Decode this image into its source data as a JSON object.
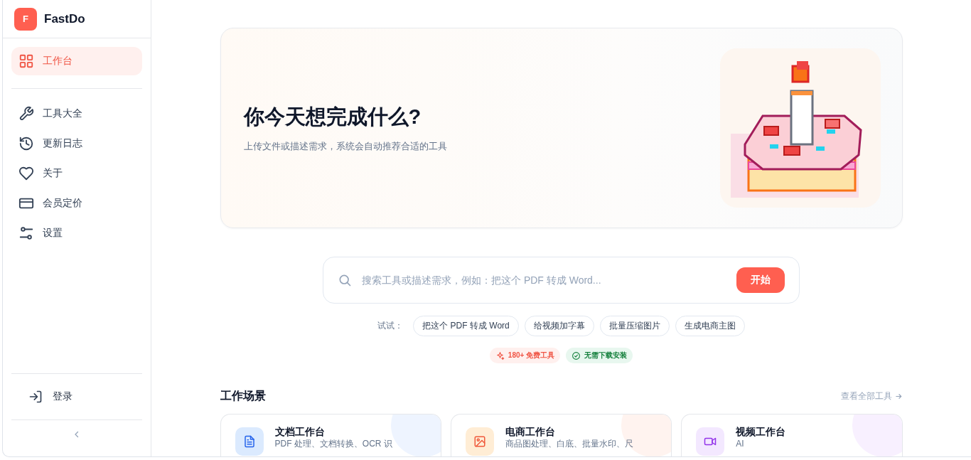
{
  "sidebar": {
    "brand": {
      "logo_letter": "F",
      "name": "FastDo"
    },
    "primary": [
      {
        "label": "工作台",
        "kind": "grid",
        "selected": true
      }
    ],
    "items": [
      {
        "label": "工具大全",
        "kind": "wrench",
        "selected": false
      },
      {
        "label": "更新日志",
        "kind": "history",
        "selected": false
      },
      {
        "label": "关于",
        "kind": "heart",
        "selected": false
      },
      {
        "label": "会员定价",
        "kind": "card",
        "selected": false
      },
      {
        "label": "设置",
        "kind": "sliders",
        "selected": false
      }
    ],
    "login": "登录"
  },
  "hero": {
    "title": "你今天想完成什么?",
    "subtitle": "上传文件或描述需求，系统会自动推荐合适的工具"
  },
  "search": {
    "placeholder": "搜索工具或描述需求，例如：把这个 PDF 转成 Word...",
    "button": "开始"
  },
  "suggestions": {
    "label": "试试：",
    "chips": [
      "把这个 PDF 转成 Word",
      "给视频加字幕",
      "批量压缩图片",
      "生成电商主图"
    ]
  },
  "badges": [
    {
      "kind": "free",
      "text": "180+ 免费工具"
    },
    {
      "kind": "check",
      "text": "无需下载安装"
    }
  ],
  "section": {
    "title": "工作场景",
    "link": "查看全部工具"
  },
  "cards": [
    {
      "kind": "doc",
      "title": "文档工作台",
      "subtitle": "PDF 处理、文档转换、OCR 识"
    },
    {
      "kind": "shop",
      "title": "电商工作台",
      "subtitle": "商品图处理、白底、批量水印、尺"
    },
    {
      "kind": "video",
      "title": "视频工作台",
      "subtitle": "AI"
    }
  ]
}
